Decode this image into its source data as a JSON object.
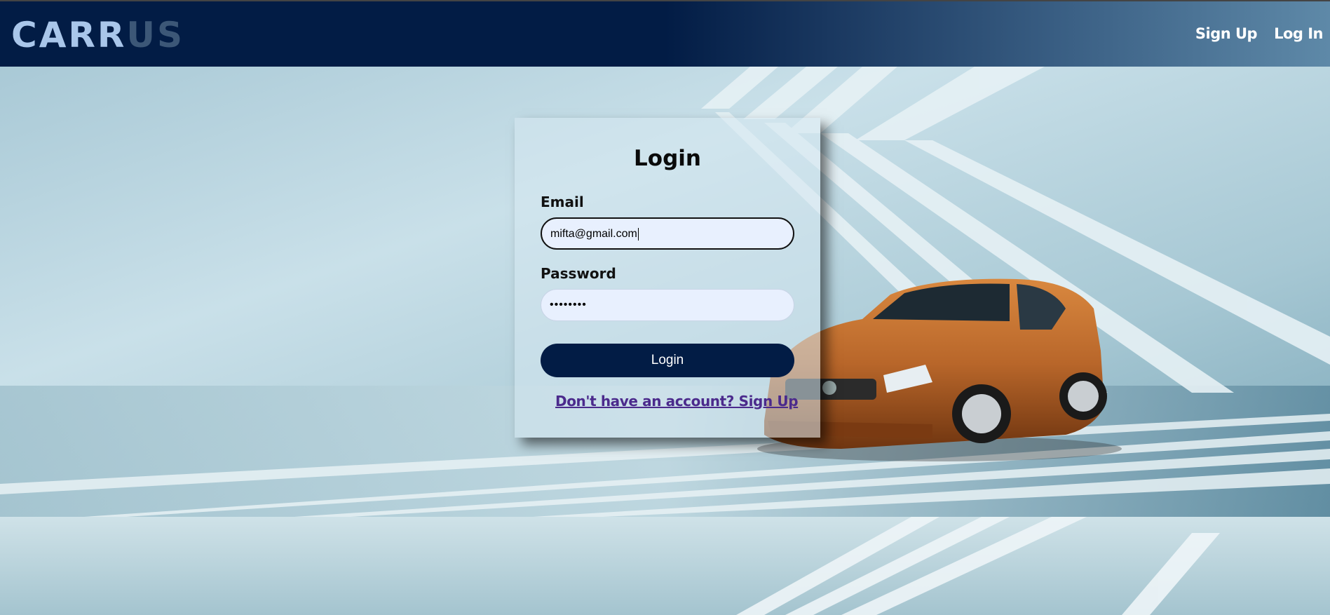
{
  "app": {
    "logo_part1": "CARR",
    "logo_part2": "US"
  },
  "nav": {
    "signup": "Sign Up",
    "login": "Log In"
  },
  "login_form": {
    "title": "Login",
    "email_label": "Email",
    "email_value": "mifta@gmail.com",
    "password_label": "Password",
    "password_value": "••••••••",
    "submit_label": "Login",
    "signup_prompt": "Don't have an account? Sign Up"
  },
  "colors": {
    "navy": "#021c45",
    "link": "#4b2a8c",
    "car_body": "#b8662a"
  },
  "icons": {
    "hero": "car-image"
  }
}
